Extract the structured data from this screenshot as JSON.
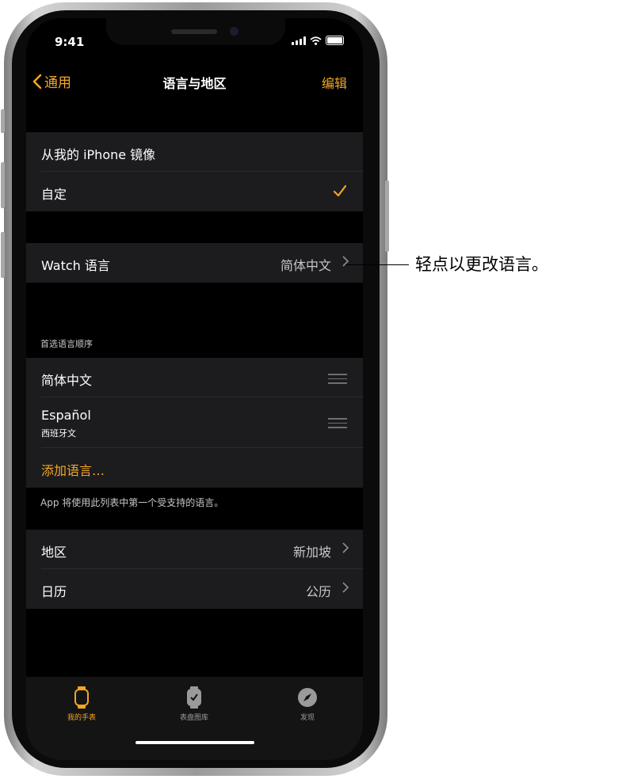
{
  "status": {
    "time": "9:41"
  },
  "nav": {
    "back_label": "通用",
    "title": "语言与地区",
    "edit_label": "编辑"
  },
  "mirror_group": {
    "mirror_label": "从我的 iPhone 镜像",
    "custom_label": "自定"
  },
  "watch_language": {
    "label": "Watch 语言",
    "value": "简体中文"
  },
  "preferred": {
    "header": "首选语言顺序",
    "items": [
      {
        "label": "简体中文",
        "sublabel": ""
      },
      {
        "label": "Español",
        "sublabel": "西班牙文"
      }
    ],
    "add_label": "添加语言…",
    "footer": "App 将使用此列表中第一个受支持的语言。"
  },
  "region_group": {
    "region_label": "地区",
    "region_value": "新加坡",
    "calendar_label": "日历",
    "calendar_value": "公历"
  },
  "tabs": [
    {
      "label": "我的手表",
      "icon": "watch-icon",
      "active": true
    },
    {
      "label": "表盘图库",
      "icon": "watch-face-icon",
      "active": false
    },
    {
      "label": "发现",
      "icon": "compass-icon",
      "active": false
    }
  ],
  "callout": {
    "text": "轻点以更改语言。"
  },
  "colors": {
    "accent": "#f5a623",
    "background": "#000000",
    "cell": "#1c1c1e",
    "secondary_text": "#c7c7cc"
  }
}
